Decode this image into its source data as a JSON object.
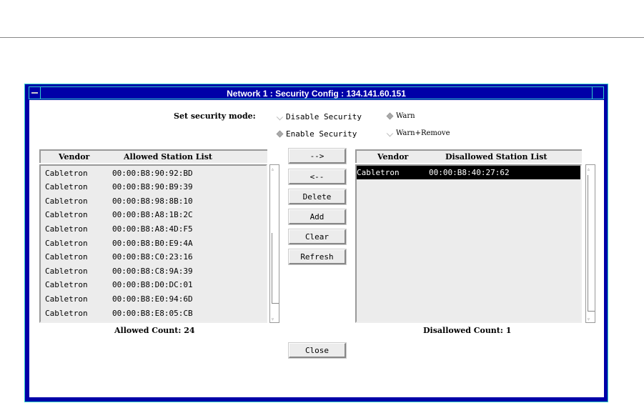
{
  "window": {
    "title": "Network 1 : Security Config : 134.141.60.151"
  },
  "security": {
    "label": "Set security mode:",
    "options": [
      {
        "label": "Disable Security",
        "selected": false
      },
      {
        "label": "Warn",
        "selected": true
      },
      {
        "label": "Enable Security",
        "selected": true
      },
      {
        "label": "Warn+Remove",
        "selected": false
      }
    ]
  },
  "allowed": {
    "col_vendor": "Vendor",
    "col_list": "Allowed Station List",
    "rows": [
      {
        "vendor": "Cabletron",
        "mac": "00:00:B8:90:92:BD"
      },
      {
        "vendor": "Cabletron",
        "mac": "00:00:B8:90:B9:39"
      },
      {
        "vendor": "Cabletron",
        "mac": "00:00:B8:98:8B:10"
      },
      {
        "vendor": "Cabletron",
        "mac": "00:00:B8:A8:1B:2C"
      },
      {
        "vendor": "Cabletron",
        "mac": "00:00:B8:A8:4D:F5"
      },
      {
        "vendor": "Cabletron",
        "mac": "00:00:B8:B0:E9:4A"
      },
      {
        "vendor": "Cabletron",
        "mac": "00:00:B8:C0:23:16"
      },
      {
        "vendor": "Cabletron",
        "mac": "00:00:B8:C8:9A:39"
      },
      {
        "vendor": "Cabletron",
        "mac": "00:00:B8:D0:DC:01"
      },
      {
        "vendor": "Cabletron",
        "mac": "00:00:B8:E0:94:6D"
      },
      {
        "vendor": "Cabletron",
        "mac": "00:00:B8:E8:05:CB"
      }
    ],
    "count_label": "Allowed Count: 24"
  },
  "disallowed": {
    "col_vendor": "Vendor",
    "col_list": "Disallowed Station List",
    "rows": [
      {
        "vendor": "Cabletron",
        "mac": "00:00:B8:40:27:62"
      }
    ],
    "count_label": "Disallowed Count: 1"
  },
  "buttons": {
    "move_right": "-->",
    "move_left": "<--",
    "delete": "Delete",
    "add": "Add",
    "clear": "Clear",
    "refresh": "Refresh",
    "close": "Close"
  }
}
